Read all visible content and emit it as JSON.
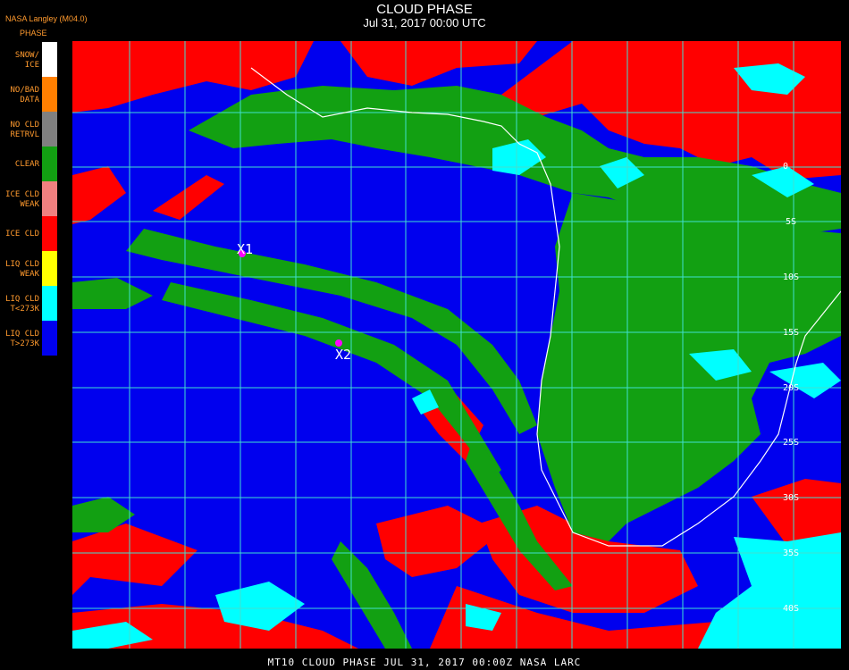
{
  "header": {
    "title": "CLOUD PHASE",
    "subtitle": "Jul 31, 2017 00:00 UTC",
    "source": "NASA Langley (M04.0)"
  },
  "legend": {
    "title": "PHASE",
    "items": [
      {
        "label": "SNOW/\nICE",
        "color": "#ffffff"
      },
      {
        "label": "NO/BAD\nDATA",
        "color": "#ff7f00"
      },
      {
        "label": "NO CLD\nRETRVL",
        "color": "#808080"
      },
      {
        "label": "CLEAR",
        "color": "#12a012"
      },
      {
        "label": "ICE CLD\nWEAK",
        "color": "#f08080"
      },
      {
        "label": "ICE CLD",
        "color": "#ff0000"
      },
      {
        "label": "LIQ CLD\nWEAK",
        "color": "#ffff00"
      },
      {
        "label": "LIQ CLD\nT<273K",
        "color": "#00ffff"
      },
      {
        "label": "LIQ CLD\nT>273K",
        "color": "#0000ee"
      }
    ]
  },
  "map": {
    "markers": [
      {
        "label": "X1"
      },
      {
        "label": "X2"
      }
    ],
    "lat_labels": [
      "0",
      "5S",
      "10S",
      "15S",
      "20S",
      "25S",
      "30S",
      "35S",
      "40S"
    ]
  },
  "footer": {
    "text": "MT10  CLOUD PHASE   JUL 31, 2017 00:00Z   NASA LARC"
  }
}
